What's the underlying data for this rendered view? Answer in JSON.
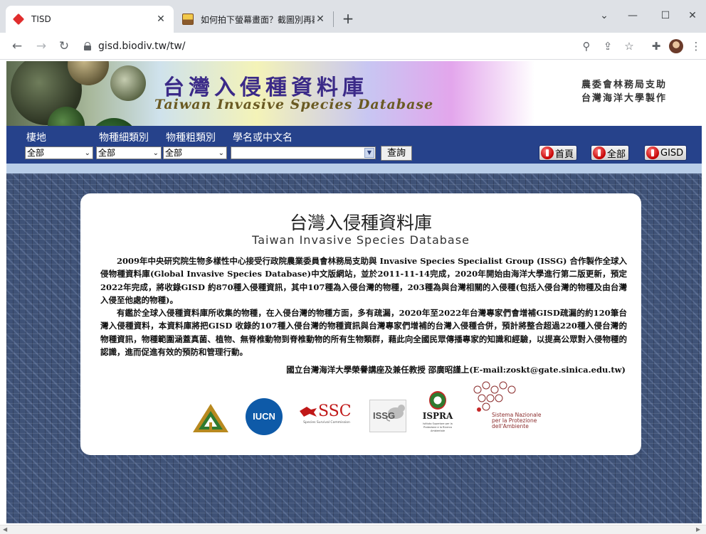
{
  "browser": {
    "tabs": [
      {
        "title": "TISD",
        "favicon": "red-diamond-icon",
        "active": true
      },
      {
        "title": "如何拍下螢幕畫面？截圖別再戳...",
        "favicon": "picture-icon",
        "active": false
      }
    ],
    "new_tab": "+",
    "window_controls": {
      "minimize": "—",
      "maximize": "☐",
      "close": "✕",
      "tab_search": "⌄"
    },
    "url": "gisd.biodiv.tw/tw/"
  },
  "banner": {
    "title_zh": "台灣入侵種資料庫",
    "title_en": "Taiwan Invasive Species Database",
    "sponsor_line1": "農委會林務局支助",
    "sponsor_line2": "台灣海洋大學製作"
  },
  "search": {
    "labels": {
      "habitat": "棲地",
      "fine_category": "物種細類別",
      "coarse_category": "物種粗類別",
      "name": "學名或中文名"
    },
    "habitat_value": "全部",
    "fine_value": "全部",
    "coarse_value": "全部",
    "name_value": "",
    "submit_label": "查詢"
  },
  "nav_buttons": {
    "home": "首頁",
    "all": "全部",
    "gisd": "GISD"
  },
  "panel": {
    "title_zh": "台灣入侵種資料庫",
    "title_en": "Taiwan  Invasive  Species  Database",
    "paragraph1": "2009年中央研究院生物多樣性中心接受行政院農業委員會林務局支助與 Invasive Species Specialist Group (ISSG) 合作製作全球入侵物種資料庫(Global Invasive Species Database)中文版網站，並於2011-11-14完成，2020年開始由海洋大學進行第二版更新，預定2022年完成，將收錄GISD 約870種入侵種資訊，其中107種為入侵台灣的物種，203種為與台灣相關的入侵種(包括入侵台灣的物種及由台灣入侵至他處的物種)。",
    "paragraph2": "有鑑於全球入侵種資料庫所收集的物種，在入侵台灣的物種方面，多有疏漏，2020年至2022年台灣專家們會增補GISD疏漏的約120筆台灣入侵種資料，本資料庫將把GISD 收錄的107種入侵台灣的物種資訊與台灣專家們增補的台灣入侵種合併，預計將整合超過220種入侵台灣的物種資訊，物種範圍涵蓋真菌、植物、無脊椎動物到脊椎動物的所有生物類群，藉此向全國民眾傳播專家的知識和經驗，以提高公眾對入侵物種的認識，進而促進有效的預防和管理行動。",
    "signature": "國立台灣海洋大學榮譽講座及兼任教授 邵廣昭謹上(E-mail:zoskt@gate.sinica.edu.tw)"
  },
  "logos": {
    "iucn": "IUCN",
    "ssc": "SSC",
    "ssc_sub": "Species Survival Commission",
    "issg": "ISSG",
    "ispra": "ISPRA",
    "ispra_sub": "Istituto Superiore per la Protezione e la Ricerca Ambientale",
    "snpa": "Sistema Nazionale per la Protezione dell'Ambiente"
  },
  "colors": {
    "nav_blue": "#26428b",
    "accent_band": "#b8cde8",
    "pattern": "#3f5277",
    "title_purple": "#3b2a88"
  }
}
